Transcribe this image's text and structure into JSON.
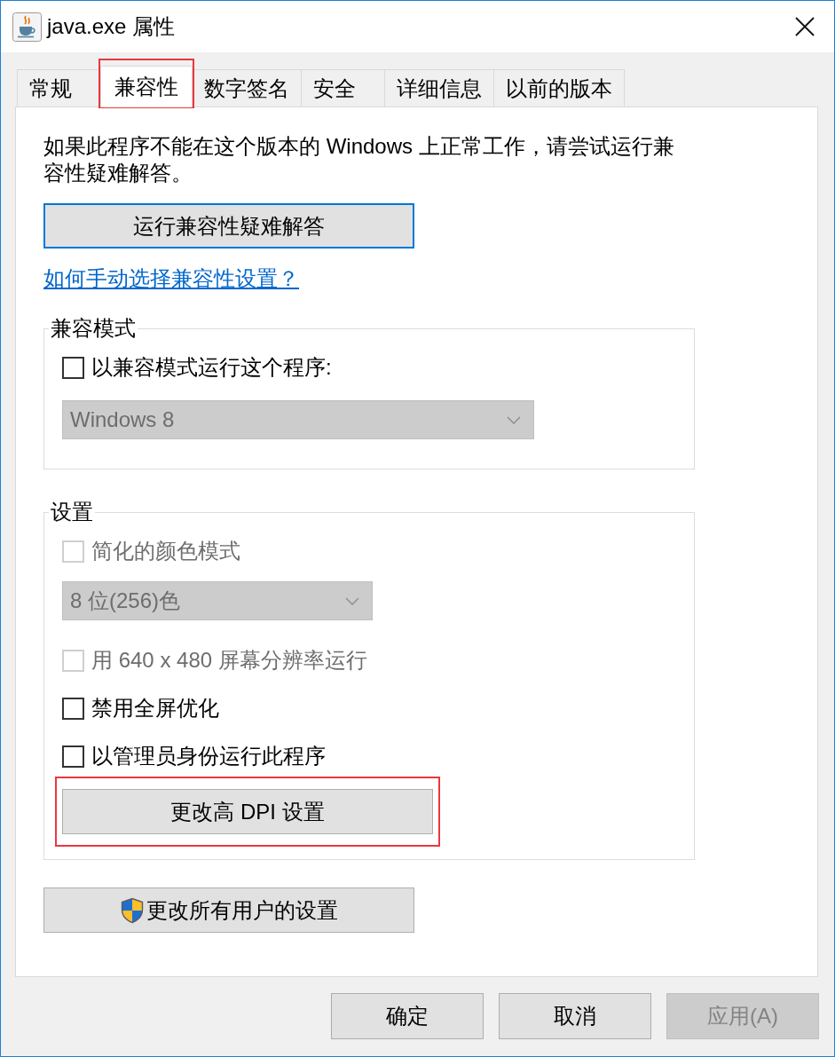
{
  "window": {
    "title": "java.exe 属性"
  },
  "tabs": [
    {
      "label": "常规",
      "selected": false,
      "highlighted": false
    },
    {
      "label": "兼容性",
      "selected": true,
      "highlighted": true
    },
    {
      "label": "数字签名",
      "selected": false,
      "highlighted": false
    },
    {
      "label": "安全",
      "selected": false,
      "highlighted": false
    },
    {
      "label": "详细信息",
      "selected": false,
      "highlighted": false
    },
    {
      "label": "以前的版本",
      "selected": false,
      "highlighted": false
    }
  ],
  "compatibility": {
    "description": "如果此程序不能在这个版本的 Windows 上正常工作，请尝试运行兼容性疑难解答。",
    "troubleshooter_button": {
      "label": "运行兼容性疑难解答",
      "focused": true
    },
    "help_link": "如何手动选择兼容性设置？",
    "compatibility_mode": {
      "title": "兼容模式",
      "items": [
        {
          "kind": "checkbox",
          "label": "以兼容模式运行这个程序:",
          "checked": false,
          "disabled": false
        },
        {
          "kind": "dropdown",
          "value": "Windows 8",
          "disabled": true
        }
      ]
    },
    "settings": {
      "title": "设置",
      "items": [
        {
          "kind": "checkbox",
          "label": "简化的颜色模式",
          "checked": false,
          "disabled": true
        },
        {
          "kind": "dropdown",
          "value": "8 位(256)色",
          "disabled": true
        },
        {
          "kind": "checkbox",
          "label": "用 640 x 480 屏幕分辨率运行",
          "checked": false,
          "disabled": true
        },
        {
          "kind": "checkbox",
          "label": "禁用全屏优化",
          "checked": false,
          "disabled": false
        },
        {
          "kind": "checkbox",
          "label": "以管理员身份运行此程序",
          "checked": false,
          "disabled": false
        },
        {
          "kind": "button",
          "label": "更改高 DPI 设置",
          "highlighted": true
        }
      ]
    },
    "all_users_button": {
      "label": "更改所有用户的设置"
    }
  },
  "buttons": [
    {
      "label": "确定",
      "disabled": false
    },
    {
      "label": "取消",
      "disabled": false
    },
    {
      "label": "应用(A)",
      "disabled": true
    }
  ]
}
